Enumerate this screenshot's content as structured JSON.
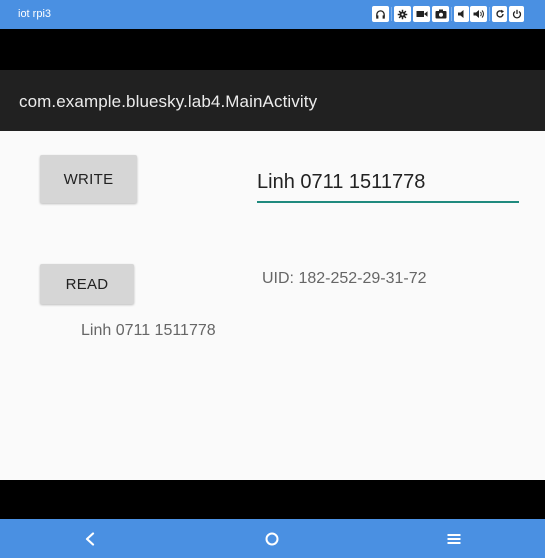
{
  "window": {
    "title": "iot rpi3"
  },
  "toolbar": {
    "icons": [
      "headphones-icon",
      "settings-icon",
      "video-icon",
      "camera-icon",
      "volume-down-icon",
      "volume-up-icon",
      "rotate-icon",
      "power-icon"
    ]
  },
  "app": {
    "title": "com.example.bluesky.lab4.MainActivity"
  },
  "main": {
    "write_label": "WRITE",
    "read_label": "READ",
    "input_value": "Linh 0711 1511778",
    "uid_text": "UID: 182-252-29-31-72",
    "read_result": "Linh 0711 1511778"
  },
  "navbar": {
    "icons": [
      "back-icon",
      "home-icon",
      "menu-icon"
    ]
  },
  "colors": {
    "accent": "#4a90e2",
    "appbar": "#212121",
    "underline": "#1f8a7e"
  }
}
